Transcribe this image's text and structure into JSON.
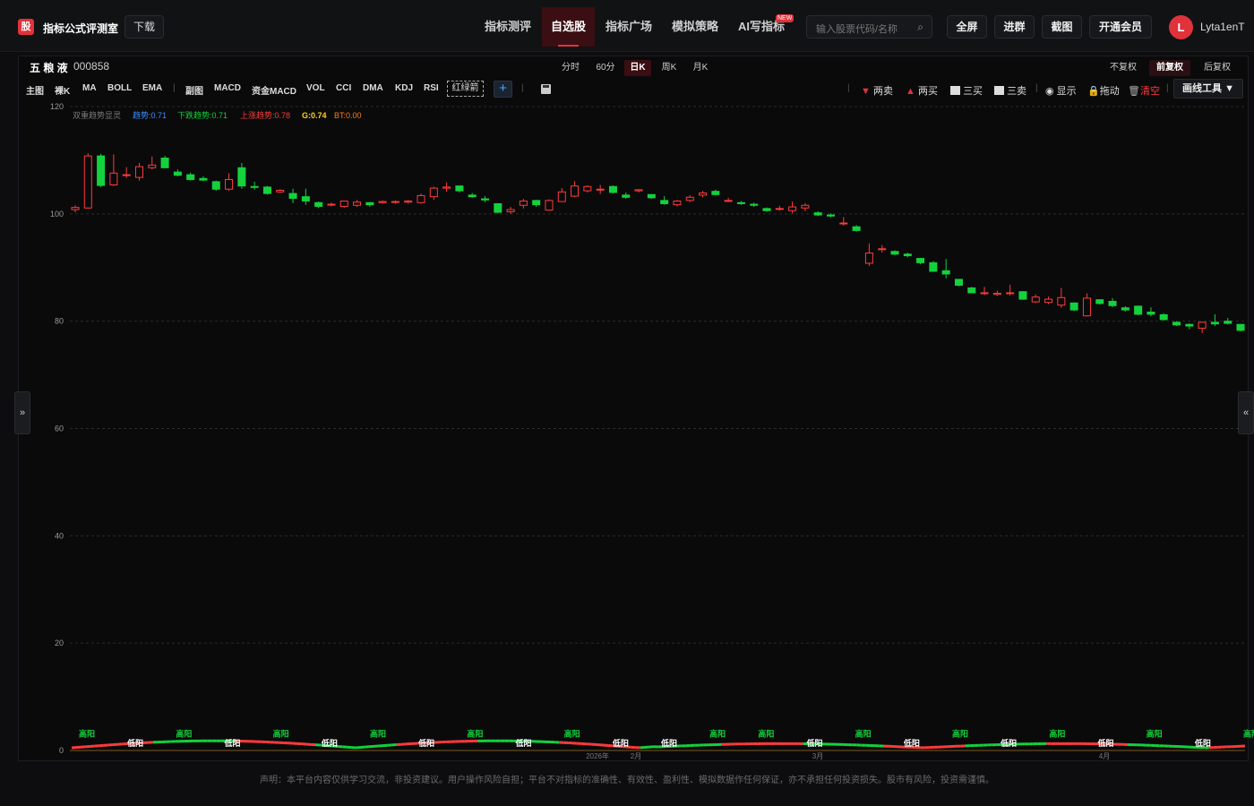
{
  "header": {
    "logo_glyph": "股",
    "brand": "指标公式评测室",
    "download": "下载",
    "nav": [
      "指标测评",
      "自选股",
      "指标广场",
      "模拟策略",
      "AI写指标"
    ],
    "nav_active_index": 1,
    "new_badge": "NEW",
    "search_placeholder": "输入股票代码/名称",
    "buttons": [
      "全屏",
      "进群",
      "截图",
      "开通会员"
    ],
    "avatar_letter": "L",
    "username": "Lyta1enT"
  },
  "stock": {
    "name": "五 粮 液",
    "code": "000858"
  },
  "periods": [
    "分时",
    "60分",
    "日K",
    "周K",
    "月K"
  ],
  "period_active": "日K",
  "adjust": [
    "不复权",
    "前复权",
    "后复权"
  ],
  "adjust_active": "前复权",
  "main_indicators": [
    "主图",
    "裸K",
    "MA",
    "BOLL",
    "EMA"
  ],
  "sub_indicators": [
    "副图",
    "MACD",
    "资金MACD",
    "VOL",
    "CCI",
    "DMA",
    "KDJ",
    "RSI"
  ],
  "red_green_label": "红绿箭",
  "plus_label": "+",
  "draw_tools": {
    "two_sell": "两卖",
    "two_buy": "两买",
    "three_buy": "三买",
    "three_sell": "三卖",
    "show": "显示",
    "drag": "拖动",
    "clear": "清空",
    "draw_tool": "画线工具 ▼"
  },
  "colors": {
    "up": "#ff3b3b",
    "down": "#14d23c",
    "accent": "#e0323b",
    "gold": "#ffd21e",
    "blue": "#3a8eff"
  },
  "indicator_legend": {
    "name": "双重趋势显灵",
    "trend": "趋势:0.71",
    "down": "下跌趋势:0.71",
    "up": "上涨趋势:0.78",
    "g": "G:0.74",
    "bt": "BT:0.00"
  },
  "side_left": "»",
  "side_right": "«",
  "footer": "声明：本平台内容仅供学习交流，非投资建议。用户操作风险自担；平台不对指标的准确性、有效性、盈利性、模拟数据作任何保证，亦不承担任何投资损失。股市有风险，投资需谨慎。",
  "chart_data": {
    "type": "candlestick",
    "ylim": [
      0,
      120
    ],
    "yticks": [
      0,
      20,
      40,
      60,
      80,
      100,
      120
    ],
    "xticks": [
      "2026年",
      "2月",
      "3月",
      "4月"
    ],
    "candles": [
      [
        100.8,
        101.2,
        100.3,
        101.6
      ],
      [
        101.1,
        110.8,
        101.0,
        111.3
      ],
      [
        110.8,
        105.3,
        105.0,
        111.2
      ],
      [
        105.4,
        107.6,
        105.2,
        111.1
      ],
      [
        107.2,
        107.3,
        106.7,
        108.7
      ],
      [
        106.8,
        108.8,
        106.2,
        109.5
      ],
      [
        108.6,
        109.1,
        108.3,
        110.7
      ],
      [
        110.4,
        108.6,
        108.5,
        110.8
      ],
      [
        107.8,
        107.2,
        107.0,
        108.3
      ],
      [
        107.3,
        106.4,
        106.2,
        107.7
      ],
      [
        106.6,
        106.3,
        106.1,
        107.0
      ],
      [
        106.0,
        104.6,
        104.3,
        106.2
      ],
      [
        104.6,
        106.4,
        104.3,
        107.6
      ],
      [
        108.6,
        105.2,
        104.7,
        109.5
      ],
      [
        105.1,
        105.0,
        104.5,
        106.0
      ],
      [
        105.0,
        103.8,
        103.6,
        105.2
      ],
      [
        104.1,
        104.4,
        103.9,
        104.6
      ],
      [
        103.8,
        102.9,
        102.0,
        104.7
      ],
      [
        103.2,
        102.4,
        101.7,
        104.7
      ],
      [
        102.1,
        101.4,
        101.1,
        102.3
      ],
      [
        101.7,
        101.8,
        101.4,
        102.1
      ],
      [
        101.4,
        102.4,
        101.1,
        102.5
      ],
      [
        101.6,
        102.2,
        101.3,
        102.6
      ],
      [
        102.1,
        101.7,
        101.3,
        102.2
      ],
      [
        102.1,
        102.3,
        101.9,
        102.5
      ],
      [
        102.2,
        102.3,
        101.9,
        102.5
      ],
      [
        102.2,
        102.4,
        101.9,
        102.6
      ],
      [
        102.1,
        103.4,
        101.9,
        103.8
      ],
      [
        103.2,
        104.8,
        102.6,
        105.1
      ],
      [
        104.8,
        105.0,
        104.1,
        105.9
      ],
      [
        105.2,
        104.3,
        104.0,
        105.3
      ],
      [
        103.5,
        103.2,
        103.0,
        103.9
      ],
      [
        102.8,
        102.6,
        102.2,
        103.3
      ],
      [
        101.9,
        100.3,
        100.1,
        102.0
      ],
      [
        100.4,
        100.8,
        100.0,
        101.3
      ],
      [
        101.6,
        102.4,
        101.0,
        102.8
      ],
      [
        102.5,
        101.7,
        101.3,
        102.6
      ],
      [
        100.7,
        102.5,
        100.6,
        102.7
      ],
      [
        102.3,
        104.1,
        102.2,
        104.8
      ],
      [
        103.3,
        105.2,
        103.1,
        106.1
      ],
      [
        104.3,
        105.1,
        104.0,
        105.3
      ],
      [
        104.6,
        104.6,
        103.7,
        105.4
      ],
      [
        105.1,
        104.0,
        103.8,
        105.3
      ],
      [
        103.5,
        103.1,
        102.8,
        104.0
      ],
      [
        104.3,
        104.5,
        104.0,
        104.6
      ],
      [
        103.6,
        103.0,
        102.8,
        103.7
      ],
      [
        102.5,
        101.9,
        101.7,
        103.3
      ],
      [
        101.7,
        102.4,
        101.4,
        102.6
      ],
      [
        102.5,
        103.1,
        102.2,
        103.5
      ],
      [
        103.5,
        103.9,
        103.1,
        104.3
      ],
      [
        104.2,
        103.6,
        103.4,
        104.5
      ],
      [
        102.4,
        102.5,
        102.2,
        103.0
      ],
      [
        102.1,
        101.9,
        101.7,
        102.4
      ],
      [
        101.8,
        101.6,
        101.3,
        102.1
      ],
      [
        101.0,
        100.6,
        100.4,
        101.2
      ],
      [
        101.0,
        101.0,
        100.6,
        101.5
      ],
      [
        100.6,
        101.3,
        100.1,
        102.3
      ],
      [
        101.1,
        101.6,
        100.5,
        102.0
      ],
      [
        100.2,
        99.8,
        99.6,
        100.5
      ],
      [
        99.8,
        99.6,
        99.4,
        100.1
      ],
      [
        98.2,
        98.3,
        97.8,
        99.4
      ],
      [
        97.6,
        96.9,
        96.7,
        97.9
      ],
      [
        90.8,
        92.7,
        90.3,
        94.5
      ],
      [
        93.5,
        93.5,
        92.8,
        94.2
      ],
      [
        93.0,
        92.5,
        92.3,
        93.2
      ],
      [
        92.5,
        92.2,
        91.9,
        92.8
      ],
      [
        91.7,
        90.9,
        90.6,
        91.8
      ],
      [
        90.9,
        89.3,
        89.2,
        91.2
      ],
      [
        89.4,
        88.8,
        88.0,
        91.6
      ],
      [
        87.8,
        86.7,
        86.5,
        87.9
      ],
      [
        86.2,
        85.3,
        85.2,
        86.4
      ],
      [
        85.3,
        85.3,
        84.9,
        86.4
      ],
      [
        85.0,
        85.2,
        84.7,
        85.7
      ],
      [
        85.2,
        85.3,
        84.8,
        86.8
      ],
      [
        85.5,
        84.1,
        84.0,
        85.6
      ],
      [
        83.6,
        84.5,
        83.4,
        85.0
      ],
      [
        83.5,
        84.1,
        83.2,
        84.6
      ],
      [
        83.0,
        84.4,
        82.5,
        86.2
      ],
      [
        83.4,
        82.1,
        81.9,
        83.5
      ],
      [
        81.0,
        84.3,
        80.9,
        85.2
      ],
      [
        84.0,
        83.3,
        83.1,
        84.1
      ],
      [
        83.7,
        82.9,
        82.6,
        84.3
      ],
      [
        82.5,
        82.1,
        81.8,
        82.8
      ],
      [
        82.8,
        81.3,
        81.1,
        82.9
      ],
      [
        81.7,
        81.3,
        80.9,
        82.6
      ],
      [
        81.2,
        80.3,
        80.1,
        81.5
      ],
      [
        79.8,
        79.3,
        79.1,
        80.0
      ],
      [
        79.4,
        79.1,
        78.5,
        79.6
      ],
      [
        78.7,
        79.8,
        77.8,
        79.9
      ],
      [
        79.8,
        79.5,
        79.1,
        81.3
      ],
      [
        80.0,
        79.6,
        79.4,
        80.6
      ],
      [
        79.4,
        78.3,
        78.1,
        79.5
      ]
    ],
    "signal_labels": [
      "高阳",
      "低阳",
      "高阳",
      "低阳",
      "高阳",
      "低阳",
      "高阳",
      "低阳",
      "高阳",
      "低阳",
      "高阳",
      "低阳",
      "低阳",
      "高阳",
      "高阳",
      "低阳",
      "高阳",
      "低阳",
      "高阳",
      "低阳",
      "高阳",
      "低阳",
      "高阳",
      "低阳",
      "高阳"
    ]
  }
}
